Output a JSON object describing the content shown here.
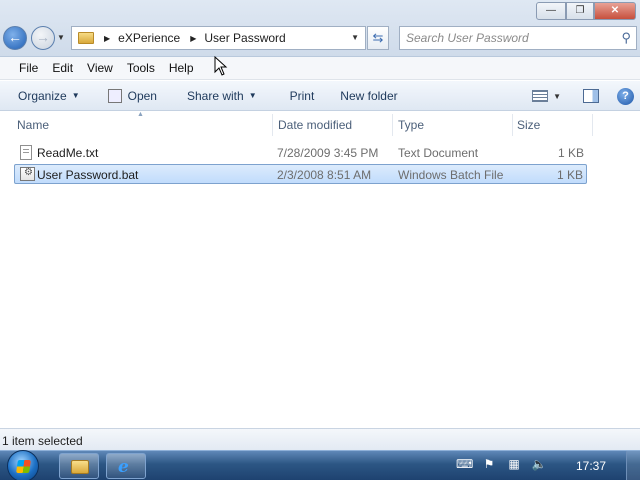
{
  "window": {
    "minimize_glyph": "—",
    "maximize_glyph": "❐",
    "close_glyph": "✕"
  },
  "address": {
    "breadcrumbs": [
      "eXPerience",
      "User Password"
    ]
  },
  "search": {
    "placeholder": "Search User Password"
  },
  "menu": {
    "items": [
      "File",
      "Edit",
      "View",
      "Tools",
      "Help"
    ]
  },
  "toolbar": {
    "organize": "Organize",
    "open": "Open",
    "share_with": "Share with",
    "print": "Print",
    "new_folder": "New folder"
  },
  "columns": {
    "name": "Name",
    "date_modified": "Date modified",
    "type": "Type",
    "size": "Size"
  },
  "files": [
    {
      "name": "ReadMe.txt",
      "date": "7/28/2009 3:45 PM",
      "type": "Text Document",
      "size": "1 KB",
      "icon": "text-file-icon",
      "selected": false
    },
    {
      "name": "User Password.bat",
      "date": "2/3/2008 8:51 AM",
      "type": "Windows Batch File",
      "size": "1 KB",
      "icon": "batch-file-icon",
      "selected": true
    }
  ],
  "status": {
    "text": "1 item selected"
  },
  "taskbar": {
    "clock": "17:37",
    "pinned": [
      "windows-explorer-icon",
      "internet-explorer-icon"
    ],
    "tray_icons": [
      "keyboard-icon",
      "action-center-flag-icon",
      "network-icon",
      "volume-muted-icon"
    ]
  },
  "colors": {
    "selection": "#c1dcfc",
    "selection_border": "#7da2ce",
    "taskbar": "#2c5684"
  }
}
